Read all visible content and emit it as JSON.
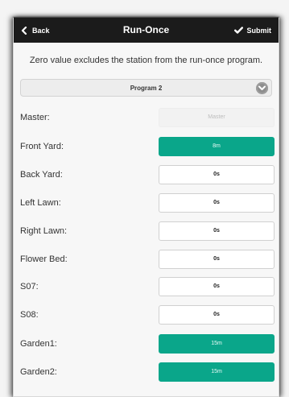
{
  "header": {
    "back_label": "Back",
    "title": "Run-Once",
    "submit_label": "Submit"
  },
  "description": "Zero value excludes the station from the run-once program.",
  "program_select": {
    "selected": "Program 2"
  },
  "stations": [
    {
      "label": "Master:",
      "value": "Master",
      "state": "disabled"
    },
    {
      "label": "Front Yard:",
      "value": "8m",
      "state": "active"
    },
    {
      "label": "Back Yard:",
      "value": "0s",
      "state": "zero"
    },
    {
      "label": "Left Lawn:",
      "value": "0s",
      "state": "zero"
    },
    {
      "label": "Right Lawn:",
      "value": "0s",
      "state": "zero"
    },
    {
      "label": "Flower Bed:",
      "value": "0s",
      "state": "zero"
    },
    {
      "label": "S07:",
      "value": "0s",
      "state": "zero"
    },
    {
      "label": "S08:",
      "value": "0s",
      "state": "zero"
    },
    {
      "label": "Garden1:",
      "value": "15m",
      "state": "active"
    },
    {
      "label": "Garden2:",
      "value": "15m",
      "state": "active"
    }
  ],
  "colors": {
    "header_bg": "#1b1b1b",
    "active_field": "#0aa68a",
    "page_bg": "#f7f7f7"
  }
}
